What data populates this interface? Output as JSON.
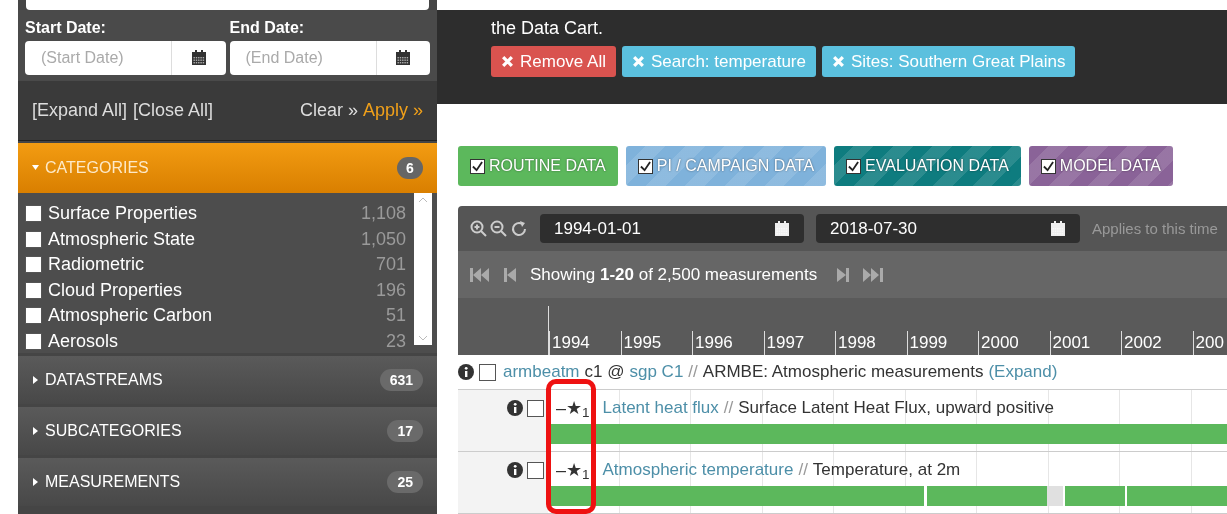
{
  "sidebar": {
    "start_label": "Start Date:",
    "end_label": "End Date:",
    "start_placeholder": "(Start Date)",
    "end_placeholder": "(End Date)",
    "expand_all": "[Expand All]",
    "close_all": "[Close All]",
    "clear": "Clear »",
    "apply": "Apply »",
    "sections": [
      {
        "title": "CATEGORIES",
        "count": "6",
        "expanded": true,
        "items": [
          {
            "label": "Surface Properties",
            "count": "1,108",
            "checked": false
          },
          {
            "label": "Atmospheric State",
            "count": "1,050",
            "checked": false
          },
          {
            "label": "Radiometric",
            "count": "701",
            "checked": false
          },
          {
            "label": "Cloud Properties",
            "count": "196",
            "checked": false
          },
          {
            "label": "Atmospheric Carbon",
            "count": "51",
            "checked": false
          },
          {
            "label": "Aerosols",
            "count": "23",
            "checked": false
          }
        ]
      },
      {
        "title": "DATASTREAMS",
        "count": "631",
        "expanded": false
      },
      {
        "title": "SUBCATEGORIES",
        "count": "17",
        "expanded": false
      },
      {
        "title": "MEASUREMENTS",
        "count": "25",
        "expanded": false
      }
    ]
  },
  "banner": {
    "text": "the Data Cart.",
    "filters": [
      {
        "kind": "remove-all",
        "label": "Remove All"
      },
      {
        "kind": "filter",
        "label": "Search: temperature"
      },
      {
        "kind": "filter",
        "label": "Sites: Southern Great Plains"
      }
    ]
  },
  "data_types": [
    {
      "label": "ROUTINE DATA",
      "checked": true,
      "color": "#5cb85c",
      "kind": "solid"
    },
    {
      "label": "PI / CAMPAIGN DATA",
      "checked": true,
      "color": "#7fb2db",
      "kind": "striped"
    },
    {
      "label": "EVALUATION DATA",
      "checked": true,
      "color": "#0e7c7f",
      "kind": "striped"
    },
    {
      "label": "MODEL DATA",
      "checked": true,
      "color": "#8a6398",
      "kind": "striped"
    }
  ],
  "timeline": {
    "start_date": "1994-01-01",
    "end_date": "2018-07-30",
    "applies_note": "Applies to this time",
    "showing": "Showing **1-20** of 2,500 measurements",
    "years": [
      "1994",
      "1995",
      "1996",
      "1997",
      "1998",
      "1999",
      "2000",
      "2001",
      "2002",
      "200"
    ],
    "datastream": {
      "name": "armbeatm",
      "facility_code": "c1 @",
      "site": "sgp C1",
      "separator": "//",
      "description": "ARMBE: Atmospheric measurements",
      "expand": "(Expand)",
      "checked": false
    },
    "measurements": [
      {
        "marker": "–★$_{1}$",
        "name": "Latent heat flux",
        "separator": "//",
        "description": "Surface Latent Heat Flux, upward positive",
        "checked": false,
        "kind": "continuous"
      },
      {
        "marker": "–★$_{1}$",
        "name": "Atmospheric temperature",
        "separator": "//",
        "description": "Temperature, at 2m",
        "checked": false,
        "kind": "interrupted"
      }
    ]
  }
}
